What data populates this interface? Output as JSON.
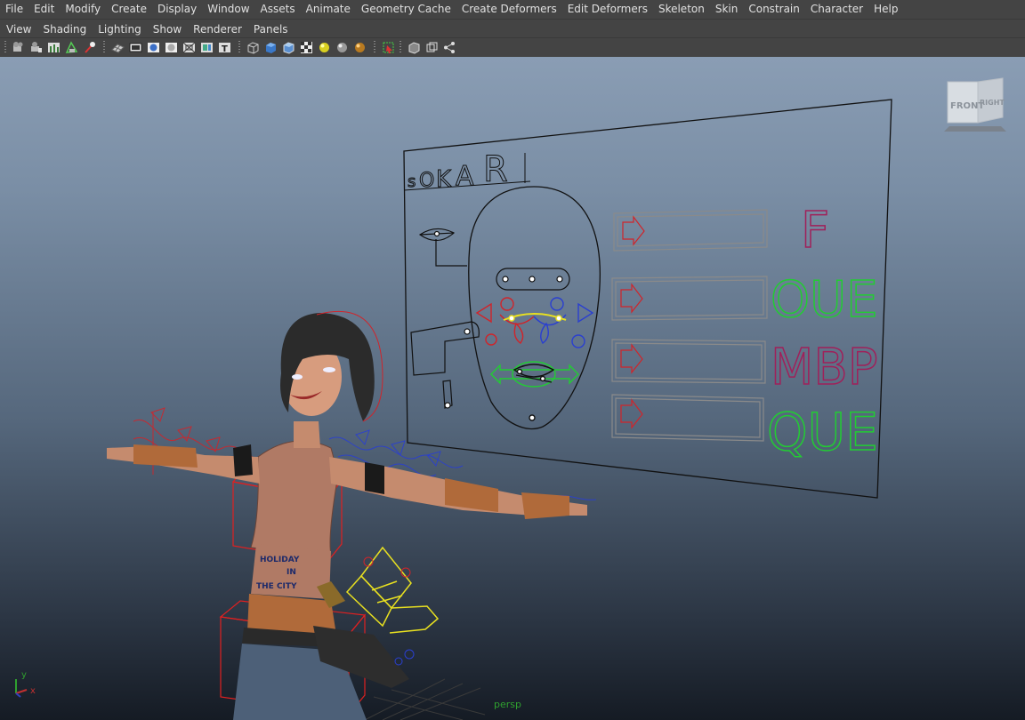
{
  "menubar": {
    "items": [
      "File",
      "Edit",
      "Modify",
      "Create",
      "Display",
      "Window",
      "Assets",
      "Animate",
      "Geometry Cache",
      "Create Deformers",
      "Edit Deformers",
      "Skeleton",
      "Skin",
      "Constrain",
      "Character",
      "Help"
    ]
  },
  "panel_menu": {
    "items": [
      "View",
      "Shading",
      "Lighting",
      "Show",
      "Renderer",
      "Panels"
    ]
  },
  "toolbar": {
    "icons": [
      "select-camera-icon",
      "lock-camera-icon",
      "camera-attributes-icon",
      "bookmark-icon",
      "image-plane-icon",
      "grid-icon",
      "film-gate-icon",
      "resolution-gate-icon",
      "gate-mask-icon",
      "field-chart-icon",
      "safe-action-icon",
      "safe-title-icon",
      "wireframe-icon",
      "smooth-shade-icon",
      "default-material-icon",
      "textured-icon",
      "use-all-lights-icon",
      "shadows-icon",
      "high-quality-icon",
      "isolate-select-icon",
      "xray-icon",
      "xray-joints-icon",
      "xray-components-icon"
    ]
  },
  "viewport": {
    "camera_name": "persp",
    "viewcube": {
      "front_label": "FRONT",
      "right_label": "RIGHT"
    },
    "axis": {
      "x_label": "x",
      "y_label": "y"
    }
  },
  "facial_rig_board": {
    "title_letters": [
      "s",
      "O",
      "K",
      "A",
      "R"
    ],
    "phoneme_labels": [
      "F",
      "OUE",
      "MBP",
      "QUE"
    ],
    "phoneme_colors": [
      "#a0205a",
      "#22cc33",
      "#a0205a",
      "#22cc33"
    ]
  },
  "character": {
    "shirt_line1": "HOLIDAY",
    "shirt_line2": "IN",
    "shirt_line3": "THE CITY"
  },
  "colors": {
    "ui_bg": "#444444",
    "ui_text": "#e0e0e0",
    "rig_red": "#d0242a",
    "rig_blue": "#2a3fd0",
    "rig_green": "#22cc33",
    "rig_yellow": "#e8e020",
    "rig_magenta": "#a0205a",
    "camera_label_green": "#2fa02f"
  }
}
